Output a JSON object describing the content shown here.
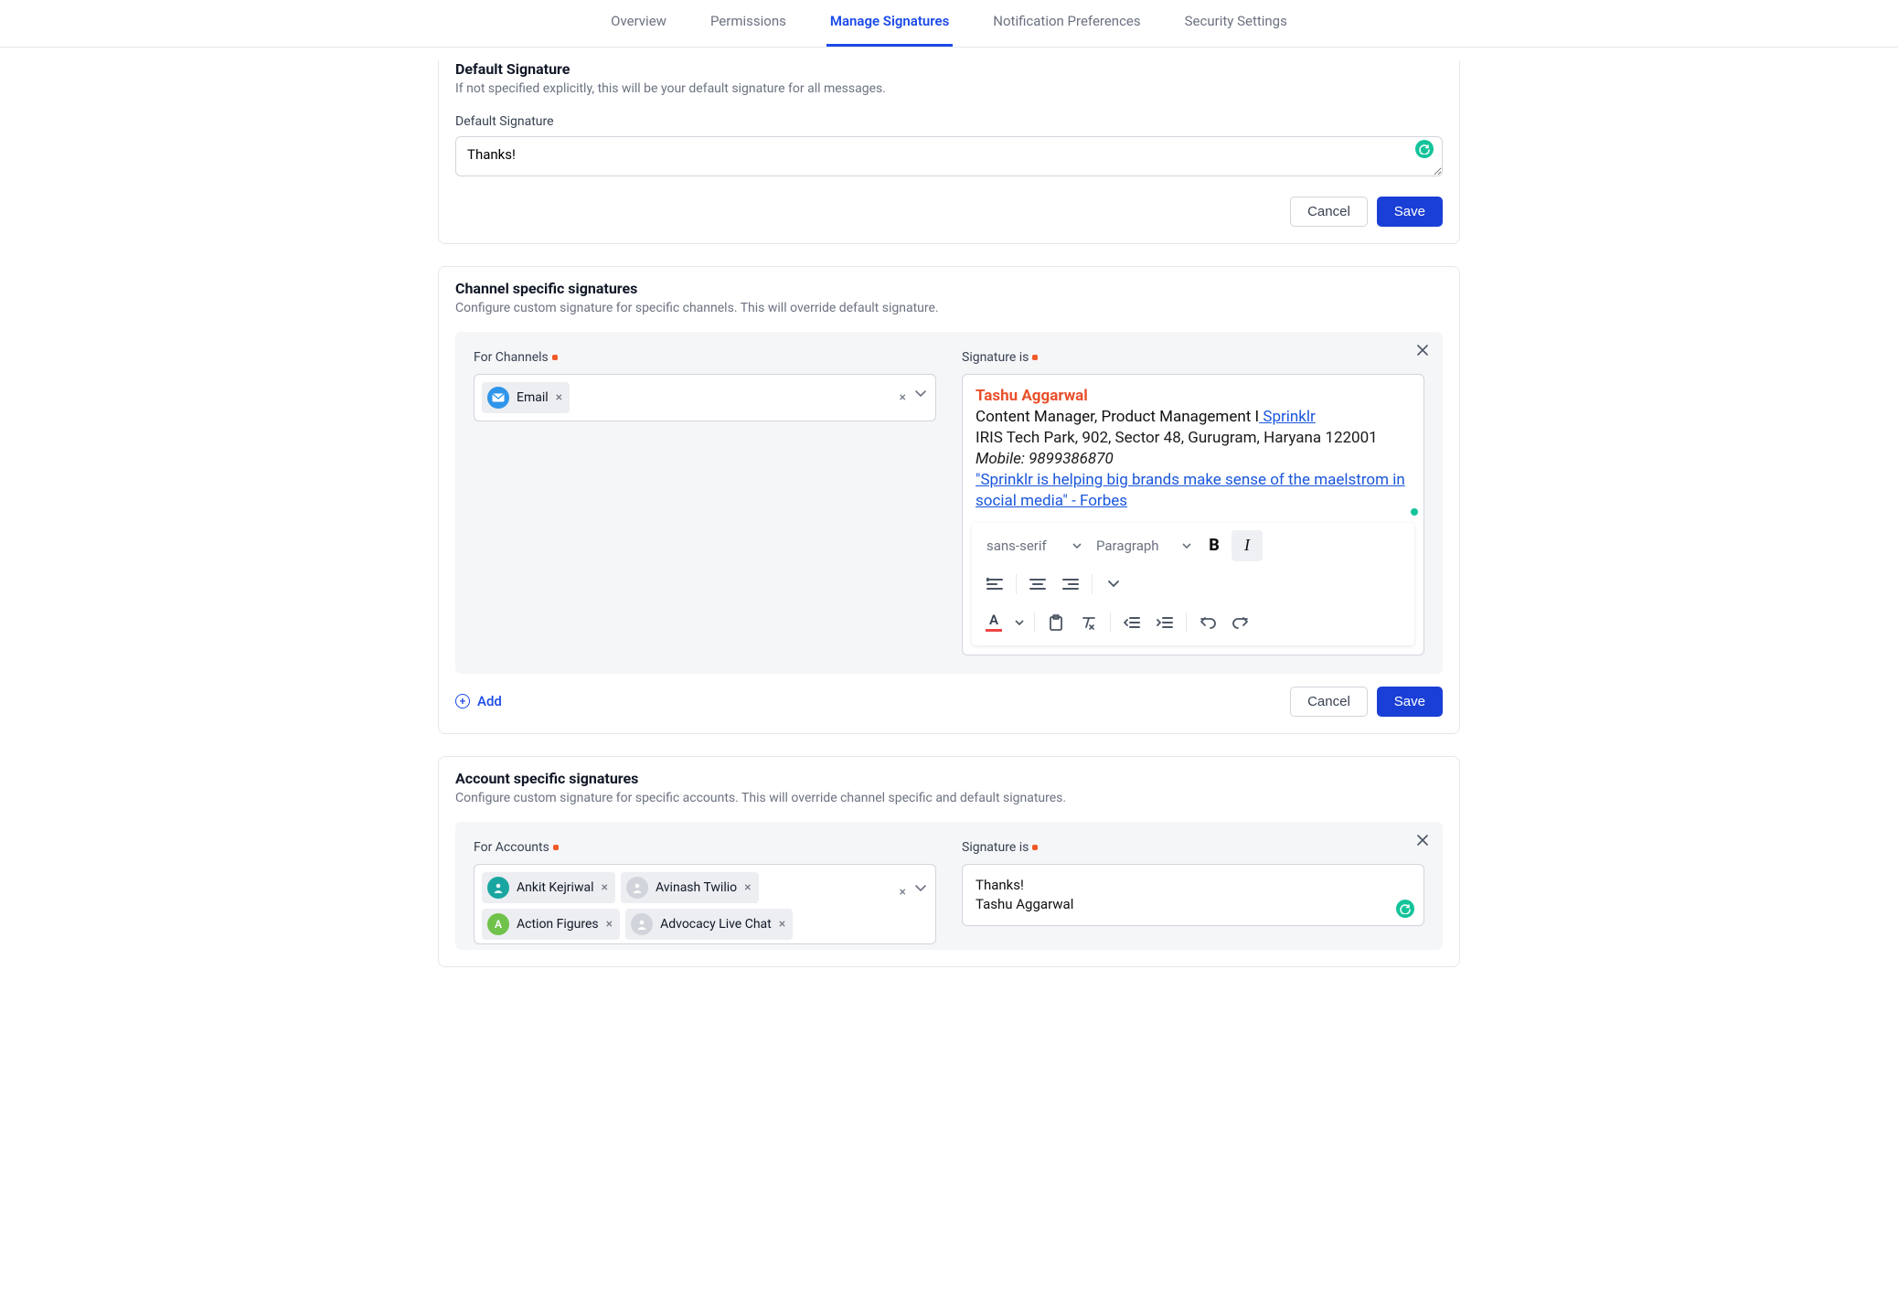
{
  "tabs": {
    "overview": "Overview",
    "permissions": "Permissions",
    "manage_signatures": "Manage Signatures",
    "notification_preferences": "Notification Preferences",
    "security_settings": "Security Settings"
  },
  "default_sig": {
    "title": "Default Signature",
    "subtitle": "If not specified explicitly, this will be your default signature for all messages.",
    "field_label": "Default Signature",
    "value": "Thanks!",
    "cancel": "Cancel",
    "save": "Save"
  },
  "channel_sig": {
    "title": "Channel specific signatures",
    "subtitle": "Configure custom signature for specific channels. This will override default signature.",
    "for_label": "For Channels",
    "sig_label": "Signature is",
    "chips": {
      "email": "Email"
    },
    "editor": {
      "name": "Tashu Aggarwal",
      "role": "Content Manager, Product Management I",
      "company": " Sprinklr",
      "addr": "IRIS Tech Park, 902, Sector 48, Gurugram, Haryana 122001",
      "mobile": "Mobile: 9899386870",
      "quote": "\"Sprinklr is helping big brands make sense of the maelstrom in social media\" - Forbes"
    },
    "toolbar": {
      "font": "sans-serif",
      "para": "Paragraph"
    },
    "add": "Add",
    "cancel": "Cancel",
    "save": "Save"
  },
  "account_sig": {
    "title": "Account specific signatures",
    "subtitle": "Configure custom signature for specific accounts. This will override channel specific and default signatures.",
    "for_label": "For Accounts",
    "sig_label": "Signature is",
    "chips": {
      "ankit": "Ankit Kejriwal",
      "avinash": "Avinash Twilio",
      "action": "Action Figures",
      "advocacy": "Advocacy Live Chat"
    },
    "sig_line1": "Thanks!",
    "sig_line2": "Tashu Aggarwal"
  }
}
